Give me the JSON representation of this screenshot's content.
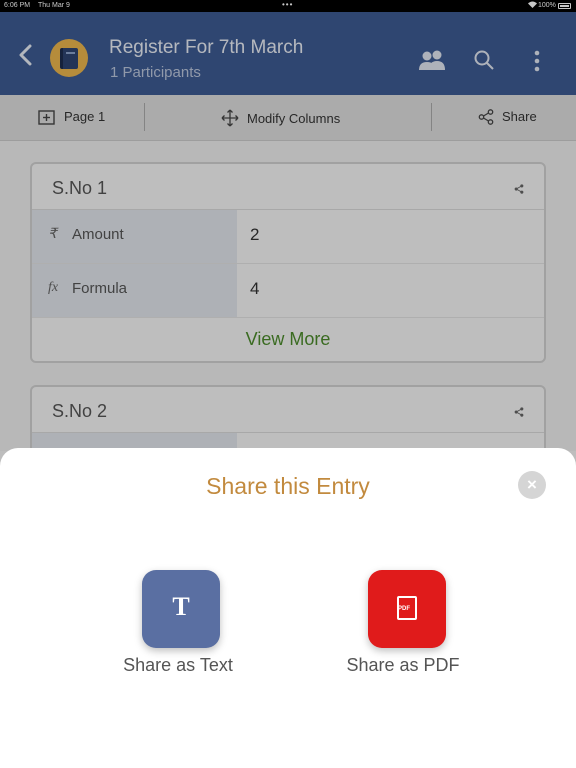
{
  "status_bar": {
    "time": "6:06 PM",
    "date": "Thu Mar 9",
    "battery": "100%"
  },
  "header": {
    "title": "Register For 7th March",
    "subtitle": "1 Participants",
    "color": "#3d5a91"
  },
  "toolbar": {
    "page_label": "Page 1",
    "modify_label": "Modify Columns",
    "share_label": "Share"
  },
  "cards": [
    {
      "title": "S.No 1",
      "rows": [
        {
          "symbol": "₹",
          "label": "Amount",
          "value": "2"
        },
        {
          "symbol": "fx",
          "label": "Formula",
          "value": "4"
        }
      ],
      "view_more": "View More"
    },
    {
      "title": "S.No 2"
    }
  ],
  "sheet": {
    "title": "Share this Entry",
    "close_icon": "close-icon",
    "options": [
      {
        "label": "Share as Text",
        "icon": "text-icon",
        "color": "#5a6fa2"
      },
      {
        "label": "Share as PDF",
        "icon": "pdf-icon",
        "color": "#e01b1b"
      }
    ]
  }
}
